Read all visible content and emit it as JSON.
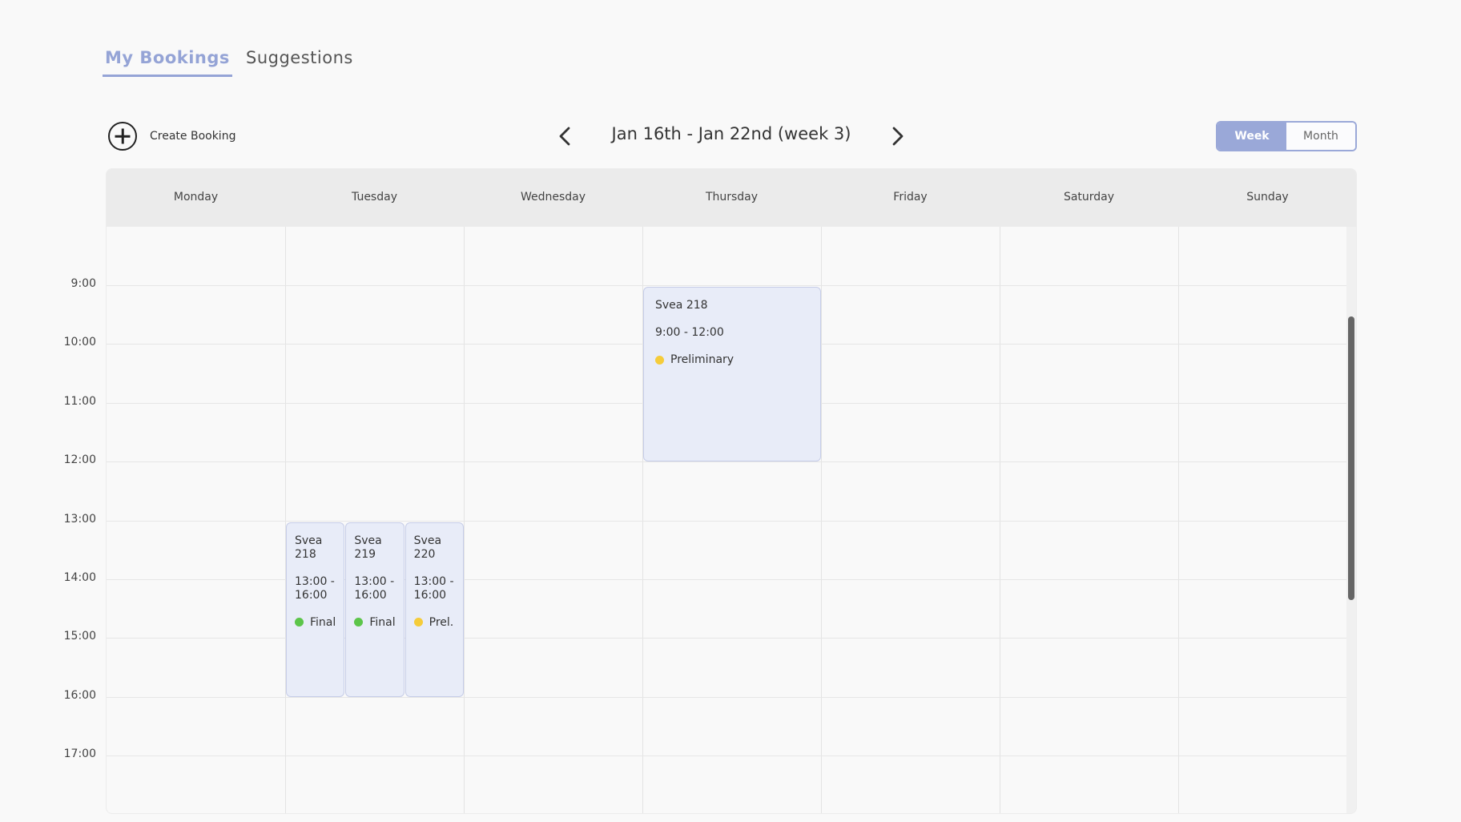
{
  "tabs": [
    {
      "label": "My Bookings",
      "active": true
    },
    {
      "label": "Suggestions",
      "active": false
    }
  ],
  "toolbar": {
    "create_label": "Create Booking",
    "create_icon": "plus-circle-icon",
    "week_range": "Jan 16th - Jan 22nd (week 3)",
    "prev_icon": "chevron-left-icon",
    "next_icon": "chevron-right-icon",
    "view_options": [
      {
        "label": "Week",
        "active": true
      },
      {
        "label": "Month",
        "active": false
      }
    ]
  },
  "calendar": {
    "days": [
      "Monday",
      "Tuesday",
      "Wednesday",
      "Thursday",
      "Friday",
      "Saturday",
      "Sunday"
    ],
    "times": [
      "9:00",
      "10:00",
      "11:00",
      "12:00",
      "13:00",
      "14:00",
      "15:00",
      "16:00",
      "17:00"
    ],
    "events": [
      {
        "title": "Svea 218",
        "time": "9:00 - 12:00",
        "status": "Preliminary",
        "status_color": "#f5cc3a",
        "day": "Thursday"
      },
      {
        "title": "Svea 218",
        "time": "13:00 - 16:00",
        "status": "Final",
        "status_color": "#5cc54a",
        "day": "Tuesday"
      },
      {
        "title": "Svea 219",
        "time": "13:00 - 16:00",
        "status": "Final",
        "status_color": "#5cc54a",
        "day": "Tuesday"
      },
      {
        "title": "Svea 220",
        "time": "13:00 - 16:00",
        "status": "Prel.",
        "status_color": "#f5cc3a",
        "day": "Tuesday"
      }
    ]
  },
  "colors": {
    "accent": "#95a4d6",
    "event_bg": "#e8ecf8",
    "header_bg": "#ebebeb"
  }
}
